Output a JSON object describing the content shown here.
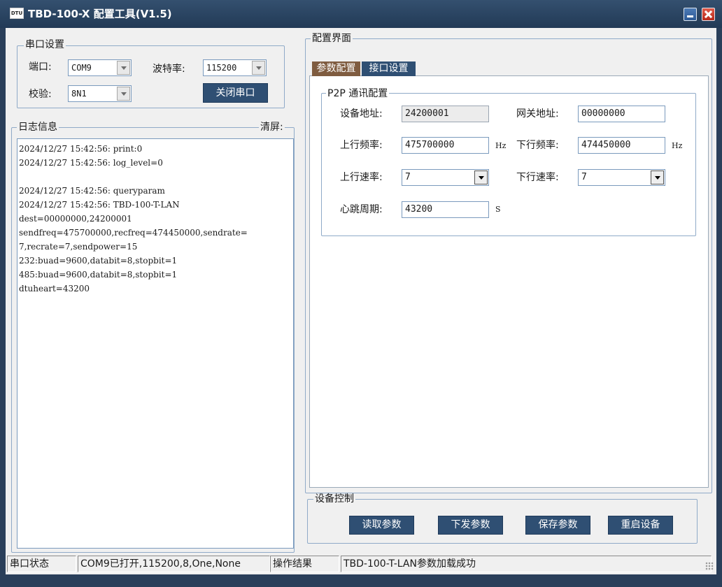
{
  "window": {
    "title": "TBD-100-X 配置工具(V1.5)",
    "icon": "DTU"
  },
  "serial": {
    "legend": "串口设置",
    "port_label": "端口:",
    "port_value": "COM9",
    "baud_label": "波特率:",
    "baud_value": "115200",
    "parity_label": "校验:",
    "parity_value": "8N1",
    "close_button": "关闭串口"
  },
  "log": {
    "legend": "日志信息",
    "clear": "清屏:",
    "lines": [
      "2024/12/27 15:42:56: print:0",
      "2024/12/27 15:42:56: log_level=0",
      "",
      "2024/12/27 15:42:56: queryparam",
      "2024/12/27 15:42:56: TBD-100-T-LAN",
      "dest=00000000,24200001",
      "sendfreq=475700000,recfreq=474450000,sendrate=",
      "7,recrate=7,sendpower=15",
      "232:buad=9600,databit=8,stopbit=1",
      "485:buad=9600,databit=8,stopbit=1",
      "dtuheart=43200"
    ]
  },
  "config": {
    "legend": "配置界面",
    "tabs": [
      "参数配置",
      "接口设置"
    ],
    "p2p": {
      "legend": "P2P 通讯配置",
      "device_addr_label": "设备地址:",
      "device_addr": "24200001",
      "gateway_addr_label": "网关地址:",
      "gateway_addr": "00000000",
      "up_freq_label": "上行频率:",
      "up_freq": "475700000",
      "up_freq_unit": "Hz",
      "down_freq_label": "下行频率:",
      "down_freq": "474450000",
      "down_freq_unit": "Hz",
      "up_rate_label": "上行速率:",
      "up_rate": "7",
      "down_rate_label": "下行速率:",
      "down_rate": "7",
      "heartbeat_label": "心跳周期:",
      "heartbeat": "43200",
      "heartbeat_unit": "S"
    }
  },
  "device_control": {
    "legend": "设备控制",
    "read": "读取参数",
    "send": "下发参数",
    "save": "保存参数",
    "restart": "重启设备"
  },
  "status_bar": {
    "serial_status_label": "串口状态",
    "serial_status": "COM9已打开,115200,8,One,None",
    "result_label": "操作结果",
    "result": "TBD-100-T-LAN参数加载成功"
  }
}
